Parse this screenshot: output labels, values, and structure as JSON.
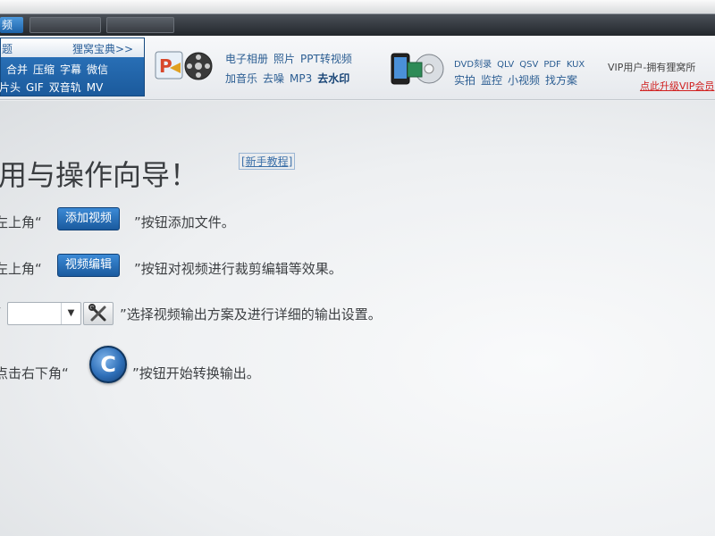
{
  "toolbar": {
    "tab_label": "频"
  },
  "tips": {
    "left": "题",
    "right": "狸窝宝典>>",
    "line1": [
      "合并",
      "压缩",
      "字幕",
      "微信"
    ],
    "line2": [
      "片头",
      "GIF",
      "双音轨",
      "MV"
    ]
  },
  "features": {
    "row1": [
      "电子相册",
      "照片",
      "PPT转视频"
    ],
    "row2": [
      "加音乐",
      "去噪",
      "MP3"
    ],
    "row2_bold": "去水印",
    "row3": [
      "DVD刻录",
      "QLV",
      "QSV",
      "PDF",
      "KUX"
    ],
    "row4": [
      "实拍",
      "监控",
      "小视频",
      "找方案"
    ],
    "vip_line1": "VIP用户-拥有狸窝所",
    "vip_line2": "点此升级VIP会员"
  },
  "main": {
    "heading": "用与操作向导！",
    "tutorial_link": "[新手教程]",
    "step1_pre": "左上角“",
    "step1_btn": "添加视频",
    "step1_post": "”按钮添加文件。",
    "step2_pre": "左上角“",
    "step2_btn": "视频编辑",
    "step2_post": "”按钮对视频进行裁剪编辑等效果。",
    "step3_pre": "“",
    "step3_post": "”选择视频输出方案及进行详细的输出设置。",
    "step4_pre": "点击右下角“",
    "step4_post": "”按钮开始转换输出。"
  },
  "colors": {
    "accent": "#1d62a8",
    "link": "#3b6fa8",
    "vip_red": "#d02020"
  }
}
